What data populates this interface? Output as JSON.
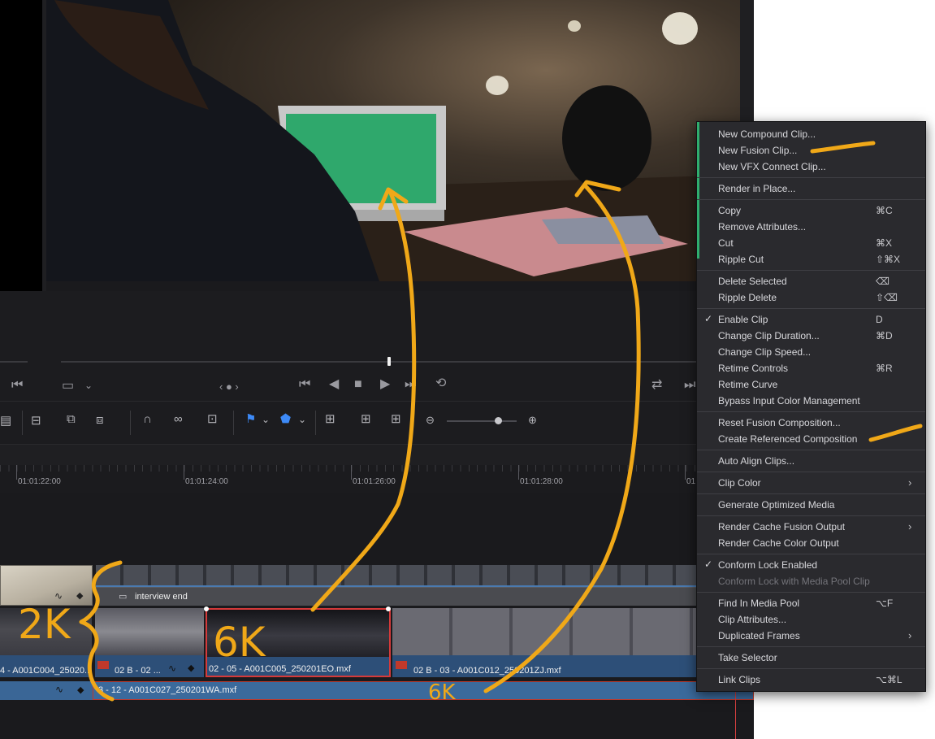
{
  "viewer": {
    "transport": [
      "go-to-start",
      "prev-frame",
      "stop",
      "play",
      "next-frame",
      "loop"
    ]
  },
  "ruler": {
    "timecodes": [
      "01:01:22:00",
      "01:01:24:00",
      "01:01:26:00",
      "01:01:28:00",
      "01"
    ]
  },
  "tracks": {
    "title_clip_label": "interview end",
    "v1_clips": [
      "4 - A001C004_25020...",
      "02 B - 02 ...",
      "02 - 05 - A001C005_250201EO.mxf",
      "02 B - 03 - A001C012_250201ZJ.mxf"
    ],
    "a1_clip": "3 - 12 - A001C027_250201WA.mxf"
  },
  "context_menu": {
    "items": [
      {
        "label": "New Compound Clip...",
        "shortcut": ""
      },
      {
        "label": "New Fusion Clip...",
        "shortcut": ""
      },
      {
        "label": "New VFX Connect Clip...",
        "shortcut": ""
      },
      {
        "label": "Render in Place...",
        "shortcut": ""
      },
      {
        "label": "Copy",
        "shortcut": "⌘C"
      },
      {
        "label": "Remove Attributes...",
        "shortcut": ""
      },
      {
        "label": "Cut",
        "shortcut": "⌘X"
      },
      {
        "label": "Ripple Cut",
        "shortcut": "⇧⌘X"
      },
      {
        "label": "Delete Selected",
        "shortcut": "⌫"
      },
      {
        "label": "Ripple Delete",
        "shortcut": "⇧⌫"
      },
      {
        "label": "Enable Clip",
        "shortcut": "D"
      },
      {
        "label": "Change Clip Duration...",
        "shortcut": "⌘D"
      },
      {
        "label": "Change Clip Speed...",
        "shortcut": ""
      },
      {
        "label": "Retime Controls",
        "shortcut": "⌘R"
      },
      {
        "label": "Retime Curve",
        "shortcut": ""
      },
      {
        "label": "Bypass Input Color Management",
        "shortcut": ""
      },
      {
        "label": "Reset Fusion Composition...",
        "shortcut": ""
      },
      {
        "label": "Create Referenced Composition",
        "shortcut": ""
      },
      {
        "label": "Auto Align Clips...",
        "shortcut": ""
      },
      {
        "label": "Clip Color",
        "shortcut": ""
      },
      {
        "label": "Generate Optimized Media",
        "shortcut": ""
      },
      {
        "label": "Render Cache Fusion Output",
        "shortcut": ""
      },
      {
        "label": "Render Cache Color Output",
        "shortcut": ""
      },
      {
        "label": "Conform Lock Enabled",
        "shortcut": ""
      },
      {
        "label": "Conform Lock with Media Pool Clip",
        "shortcut": ""
      },
      {
        "label": "Find In Media Pool",
        "shortcut": "⌥F"
      },
      {
        "label": "Clip Attributes...",
        "shortcut": ""
      },
      {
        "label": "Duplicated Frames",
        "shortcut": ""
      },
      {
        "label": "Take Selector",
        "shortcut": ""
      },
      {
        "label": "Link Clips",
        "shortcut": "⌥⌘L"
      }
    ]
  },
  "annotations": {
    "label_2k": "2K",
    "label_6k_clip": "6K",
    "label_6k_bottom": "6K",
    "color": "#f0a818"
  }
}
